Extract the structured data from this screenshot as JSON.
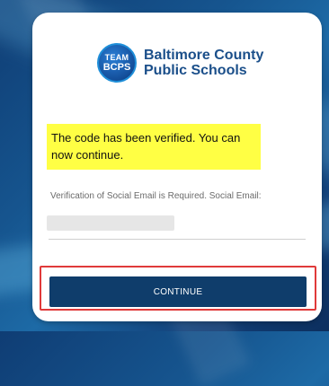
{
  "brand": {
    "badge_line1": "TEAM",
    "badge_line2": "BCPS",
    "name_line1": "Baltimore County",
    "name_line2": "Public Schools",
    "color": "#1b4f8a"
  },
  "message": {
    "verified": "The code has been verified. You can now continue.",
    "highlight_color": "#ffff44"
  },
  "form": {
    "social_email_label": "Verification of Social Email is Required. Social Email:"
  },
  "actions": {
    "continue_label": "CONTINUE",
    "button_color": "#0f3d6b",
    "focus_outline_color": "#e03a3a"
  }
}
